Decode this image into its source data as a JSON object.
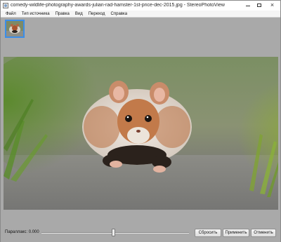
{
  "window": {
    "title": "comedy-wildlife-photography-awards-julian-rad-hamster-1st-price-dec-2015.jpg - StereoPhotoView",
    "close_glyph": "×"
  },
  "menu": {
    "items": [
      "Файл",
      "Тип источника",
      "Правка",
      "Вид",
      "Переход",
      "Справка"
    ]
  },
  "thumbnails": [
    {
      "icon": "hamster-thumbnail",
      "selected": true
    }
  ],
  "viewer": {
    "image": "hamster-photo"
  },
  "controls": {
    "parallax_label": "Параллакс: 0.000",
    "parallax_slider_position": 0.49,
    "reset_label": "Сбросить",
    "apply_label": "Применить",
    "cancel_label": "Отменить"
  },
  "colors": {
    "selection": "#3b8ee8",
    "chrome": "#a9a9a9"
  }
}
